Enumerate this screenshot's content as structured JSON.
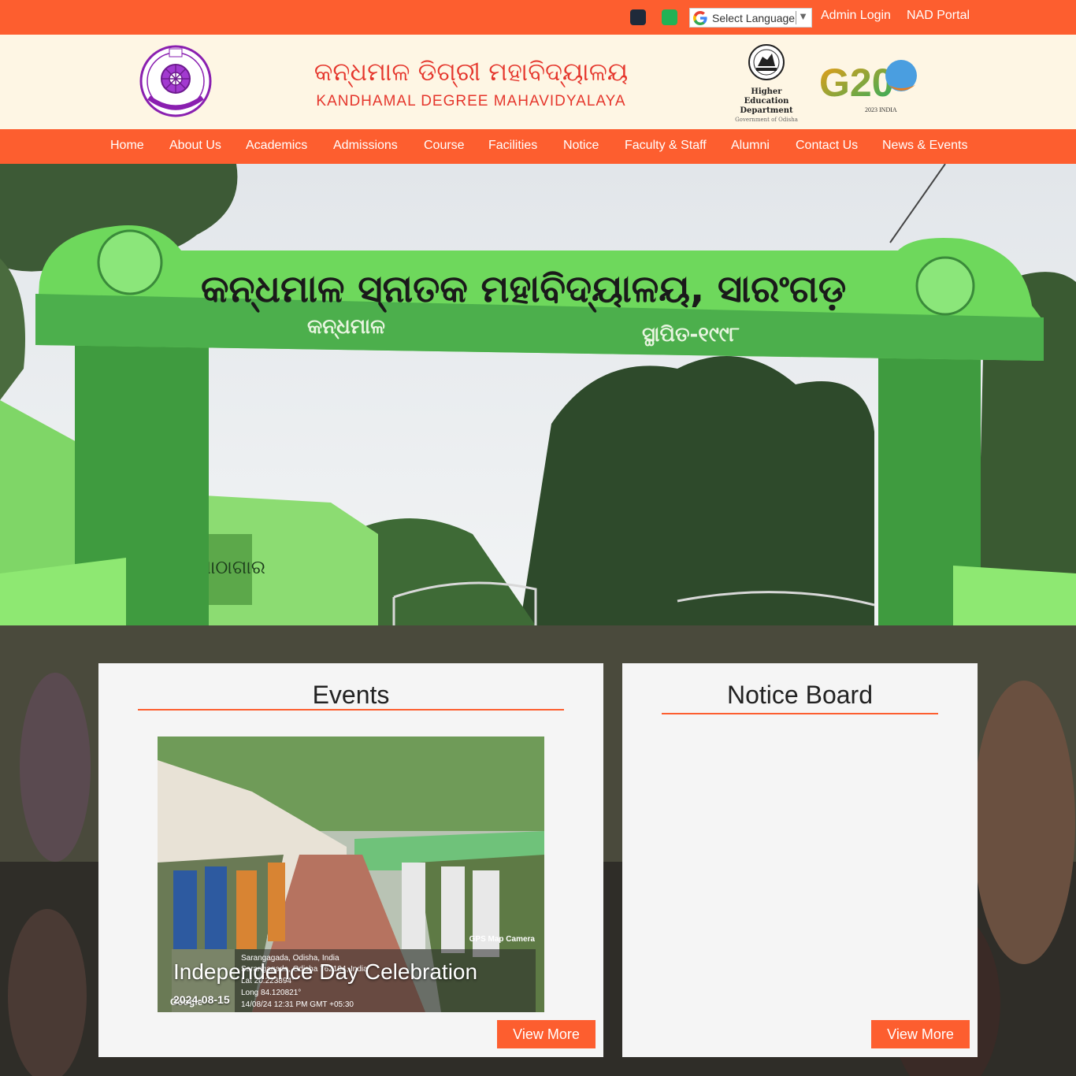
{
  "topbar": {
    "language_label": "Select Language",
    "language_arrow": "▼",
    "admin_login": "Admin Login",
    "nad_portal": "NAD Portal"
  },
  "header": {
    "title_odia": "କନ୍ଧମାଳ ଡିଗ୍ରୀ ମହାବିଦ୍ୟାଳୟ",
    "title_english": "KANDHAMAL DEGREE MAHAVIDYALAYA",
    "dept_line1": "Higher Education",
    "dept_line2": "Department",
    "dept_line3": "Government of Odisha",
    "g20_text": "G20",
    "g20_sub": "2023 INDIA"
  },
  "nav": {
    "items": [
      "Home",
      "About Us",
      "Academics",
      "Admissions",
      "Course",
      "Facilities",
      "Notice",
      "Faculty & Staff",
      "Alumni",
      "Contact Us",
      "News & Events"
    ]
  },
  "hero": {
    "gate_text_main": "କନ୍ଧମାଳ ସ୍ନାତକ ମହାବିଦ୍ୟାଳୟ, ସାରଂଗଡ଼",
    "gate_text_left": "କନ୍ଧମାଳ",
    "gate_text_right": "ସ୍ଥାପିତ-୧୯୯୮",
    "side_sign": "ପାଠାଗାର"
  },
  "events": {
    "title": "Events",
    "caption": "Independence Day Celebration",
    "date": "2024-08-15",
    "gps_camera": "GPS Map Camera",
    "gps_location": "Sarangagada, Odisha, India",
    "gps_address": "Sarangagada, Odisha 762104, India",
    "gps_lat": "Lat 20.223894°",
    "gps_long": "Long 84.120821°",
    "gps_time": "14/08/24 12:31 PM GMT +05:30",
    "google_label": "Google",
    "view_more": "View More"
  },
  "notice": {
    "title": "Notice Board",
    "view_more": "View More"
  },
  "colors": {
    "accent": "#fd5e2f",
    "header_bg": "#fef6e4",
    "title_red": "#e5362c",
    "panel_bg": "#f5f5f5"
  }
}
